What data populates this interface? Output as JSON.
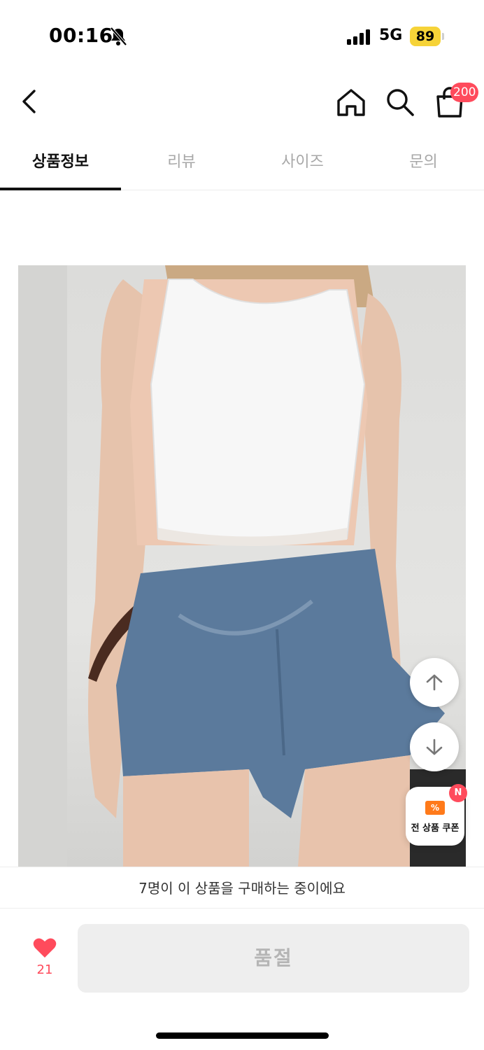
{
  "status_bar": {
    "time": "00:16",
    "network": "5G",
    "battery": "89"
  },
  "nav": {
    "cart_count": "200"
  },
  "tabs": [
    {
      "label": "상품정보",
      "active": true
    },
    {
      "label": "리뷰",
      "active": false
    },
    {
      "label": "사이즈",
      "active": false
    },
    {
      "label": "문의",
      "active": false
    }
  ],
  "coupon": {
    "label": "전 상품 쿠폰",
    "badge": "N",
    "icon_symbol": "%"
  },
  "buying_notice": "7명이 이 상품을 구매하는 중이에요",
  "bottom_bar": {
    "like_count": "21",
    "soldout_label": "품절"
  },
  "colors": {
    "accent": "#ff4b5c",
    "battery": "#f6d338",
    "coupon": "#ff7a1a"
  },
  "icons": [
    "bell-off-icon",
    "signal-icon",
    "back-arrow-icon",
    "home-icon",
    "search-icon",
    "bag-icon",
    "arrow-up-icon",
    "arrow-down-icon",
    "coupon-icon",
    "heart-icon"
  ]
}
